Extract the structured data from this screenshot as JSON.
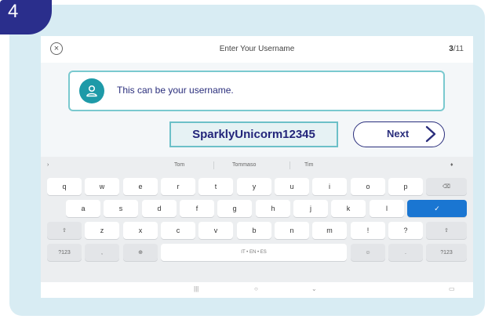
{
  "step": {
    "number": "4"
  },
  "header": {
    "title": "Enter Your Username",
    "progress_current": "3",
    "progress_total": "/11"
  },
  "hint": {
    "text": "This can be your username."
  },
  "username": {
    "value": "SparklyUnicorm12345"
  },
  "next": {
    "label": "Next"
  },
  "keyboard": {
    "suggestions": [
      "Tom",
      "Tommaso",
      "Tim"
    ],
    "row1": [
      "q",
      "w",
      "e",
      "r",
      "t",
      "y",
      "u",
      "i",
      "o",
      "p"
    ],
    "row2": [
      "a",
      "s",
      "d",
      "f",
      "g",
      "h",
      "j",
      "k",
      "l"
    ],
    "row3": [
      "z",
      "x",
      "c",
      "v",
      "b",
      "n",
      "m",
      "!",
      "?"
    ],
    "num_label": "?123",
    "comma": ",",
    "period": ".",
    "space_label": "IT • EN • ES",
    "enter_symbol": "✓"
  },
  "colors": {
    "brand_navy": "#2a2e8c",
    "teal": "#1e9aa8",
    "card_bg": "#d8ecf3",
    "enter_blue": "#1a76d2"
  }
}
